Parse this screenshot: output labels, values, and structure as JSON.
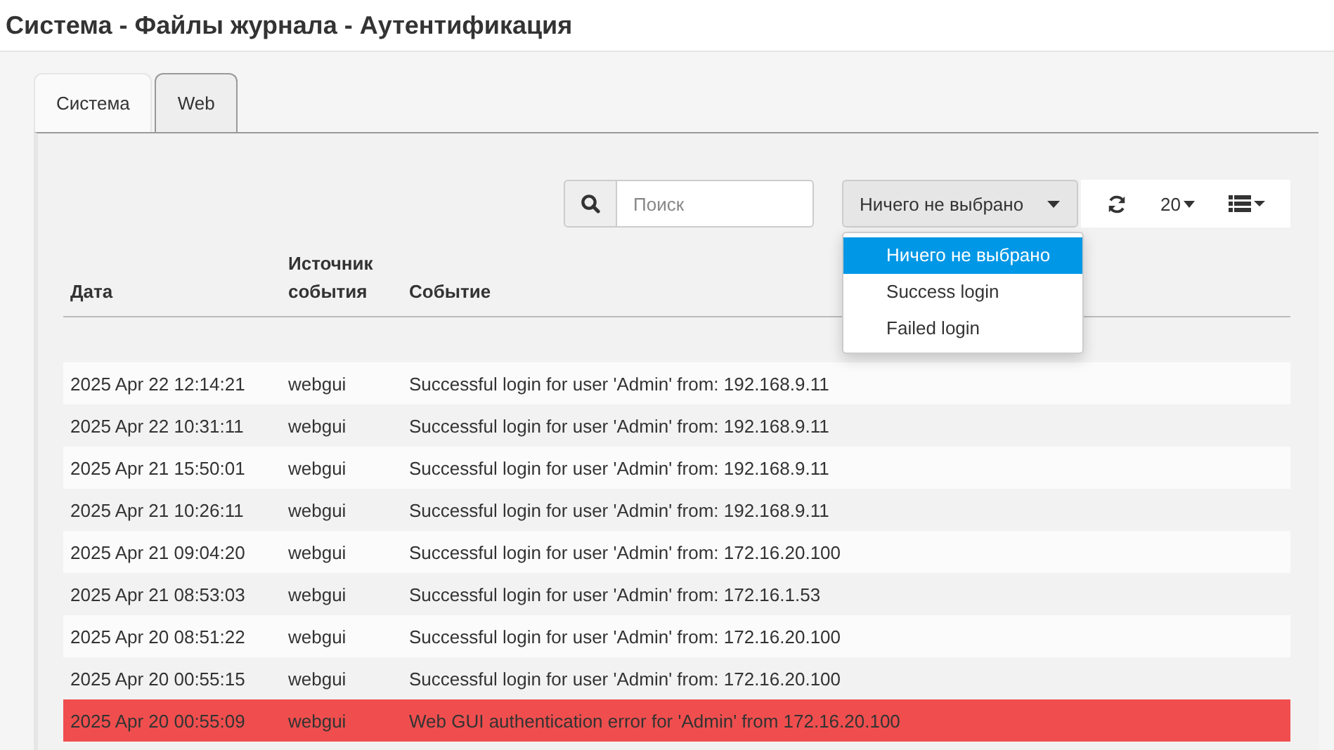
{
  "title": "Система - Файлы журнала - Аутентификация",
  "tabs": [
    {
      "label": "Система",
      "selected": false
    },
    {
      "label": "Web",
      "selected": true
    }
  ],
  "toolbar": {
    "search": {
      "placeholder": "Поиск"
    },
    "filter": {
      "value": "Ничего не выбрано",
      "options": [
        {
          "label": "Ничего не выбрано",
          "selected": true
        },
        {
          "label": "Success login",
          "selected": false
        },
        {
          "label": "Failed login",
          "selected": false
        }
      ]
    },
    "page_size": "20"
  },
  "table": {
    "columns": [
      "Дата",
      "Источник события",
      "Событие"
    ],
    "rows": [
      {
        "kind": "normal",
        "cells": [
          "2025 Apr 22 12:14:21",
          "webgui",
          "Successful login for user 'Admin' from: 192.168.9.11"
        ]
      },
      {
        "kind": "normal",
        "cells": [
          "2025 Apr 22 10:31:11",
          "webgui",
          "Successful login for user 'Admin' from: 192.168.9.11"
        ]
      },
      {
        "kind": "normal",
        "cells": [
          "2025 Apr 21 15:50:01",
          "webgui",
          "Successful login for user 'Admin' from: 192.168.9.11"
        ]
      },
      {
        "kind": "normal",
        "cells": [
          "2025 Apr 21 10:26:11",
          "webgui",
          "Successful login for user 'Admin' from: 192.168.9.11"
        ]
      },
      {
        "kind": "normal",
        "cells": [
          "2025 Apr 21 09:04:20",
          "webgui",
          "Successful login for user 'Admin' from: 172.16.20.100"
        ]
      },
      {
        "kind": "normal",
        "cells": [
          "2025 Apr 21 08:53:03",
          "webgui",
          "Successful login for user 'Admin' from: 172.16.1.53"
        ]
      },
      {
        "kind": "normal",
        "cells": [
          "2025 Apr 20 08:51:22",
          "webgui",
          "Successful login for user 'Admin' from: 172.16.20.100"
        ]
      },
      {
        "kind": "normal",
        "cells": [
          "2025 Apr 20 00:55:15",
          "webgui",
          "Successful login for user 'Admin' from: 172.16.20.100"
        ]
      },
      {
        "kind": "error",
        "cells": [
          "2025 Apr 20 00:55:09",
          "webgui",
          "Web GUI authentication error for 'Admin' from 172.16.20.100"
        ]
      }
    ]
  }
}
